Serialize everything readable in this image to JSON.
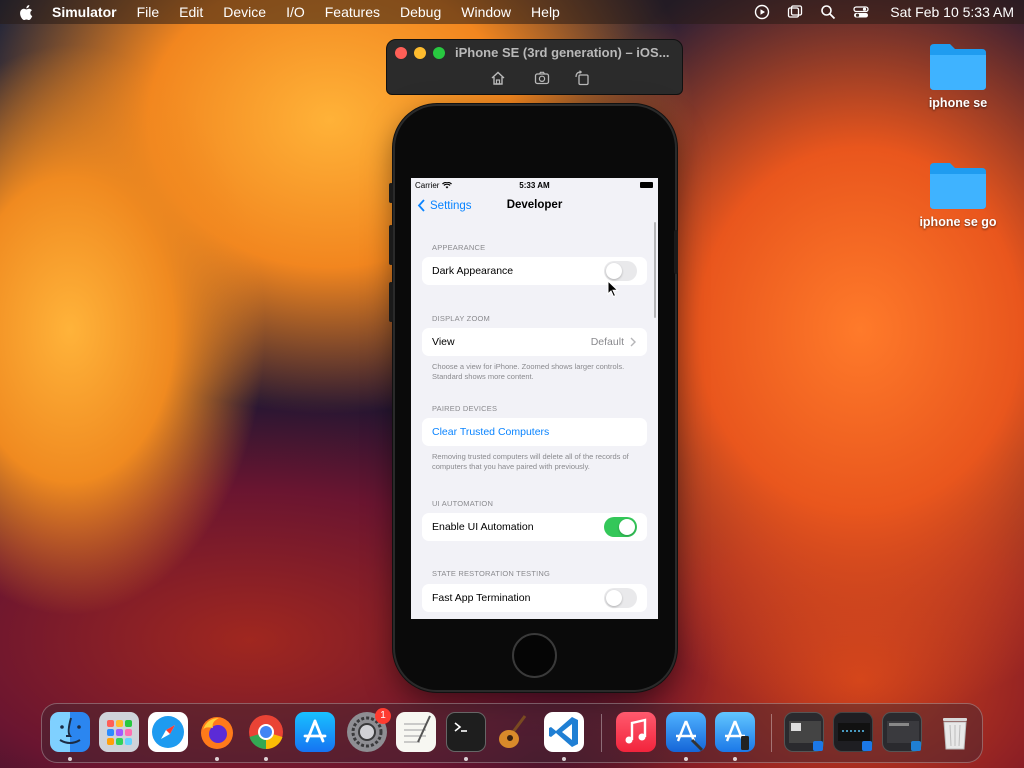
{
  "menubar": {
    "app_name": "Simulator",
    "menus": [
      "File",
      "Edit",
      "Device",
      "I/O",
      "Features",
      "Debug",
      "Window",
      "Help"
    ],
    "clock": "Sat Feb 10  5:33 AM"
  },
  "desktop": {
    "folders": [
      {
        "label": "iphone se"
      },
      {
        "label": "iphone se go"
      }
    ]
  },
  "simulator": {
    "window_title": "iPhone SE (3rd generation) – iOS..."
  },
  "ios": {
    "status": {
      "carrier": "Carrier",
      "time": "5:33 AM"
    },
    "nav": {
      "back_label": "Settings",
      "title": "Developer"
    },
    "sections": {
      "appearance": {
        "header": "APPEARANCE",
        "dark_label": "Dark Appearance",
        "dark_on": false
      },
      "zoom": {
        "header": "DISPLAY ZOOM",
        "view_label": "View",
        "view_value": "Default",
        "footer": "Choose a view for iPhone. Zoomed shows larger controls. Standard shows more content."
      },
      "paired": {
        "header": "PAIRED DEVICES",
        "clear_label": "Clear Trusted Computers",
        "footer": "Removing trusted computers will delete all of the records of computers that you have paired with previously."
      },
      "ui_automation": {
        "header": "UI AUTOMATION",
        "enable_label": "Enable UI Automation",
        "enable_on": true
      },
      "state": {
        "header": "STATE RESTORATION TESTING",
        "fast_label": "Fast App Termination",
        "fast_on": false
      }
    }
  },
  "dock": {
    "apps": [
      "finder-icon",
      "launchpad-icon",
      "safari-icon",
      "firefox-icon",
      "chrome-icon",
      "app-store-icon",
      "system-settings-icon",
      "textedit-icon",
      "terminal-icon",
      "instruments-icon",
      "vscode-icon",
      "music-icon",
      "xcode-icon",
      "simulator-icon",
      "window-thumbnail-1",
      "window-thumbnail-2",
      "window-thumbnail-3",
      "trash-icon"
    ],
    "settings_badge": "1"
  },
  "colors": {
    "ios_blue": "#0a84ff",
    "toggle_on": "#34c759",
    "toggle_off": "#e9e9eb"
  }
}
